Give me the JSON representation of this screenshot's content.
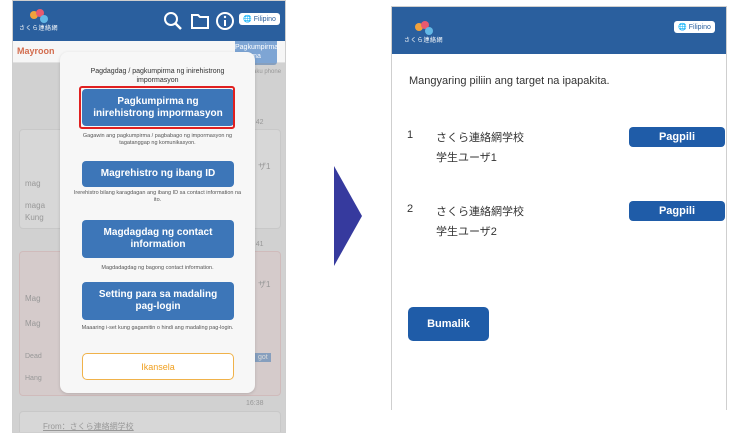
{
  "left_screen": {
    "logo_text": "さくら連絡網",
    "language_label": "Filipino",
    "subheader_name": "Mayroon",
    "subheader_button": "Pagkumpirma",
    "subheader_button_line2": "ma",
    "bg_snippets": {
      "phone": "aku phone",
      "time1": "16:42",
      "user1": "ザ1",
      "mag1": "mag",
      "mag2": "maga",
      "kung": "Kung",
      "time2": "16:41",
      "user2": "ザ1",
      "mag3": "Mag",
      "mag4": "Mag",
      "dead": "Dead",
      "hang": "Hang",
      "got": "got",
      "time3": "16:38",
      "from": "From：さくら連絡網学校"
    },
    "menu": {
      "title": "Pagdagdag / pagkumpirma ng inirehistrong impormasyon",
      "items": [
        {
          "label": "Pagkumpirma ng inirehistrong impormasyon",
          "description": "Gagawin ang pagkumpirma / pagbabago ng impormasyon ng tagatanggap ng komunikasyon."
        },
        {
          "label": "Magrehistro ng ibang ID",
          "description": "Irerehistro bilang karagdagan ang ibang ID sa contact information na ito."
        },
        {
          "label": "Magdagdag ng contact information",
          "description": "Magdadagdag ng bagong contact information."
        },
        {
          "label": "Setting para sa madaling pag-login",
          "description": "Maaaring i-set kung gagamitin o hindi ang madaling pag-login."
        }
      ],
      "cancel_label": "Ikansela"
    }
  },
  "right_screen": {
    "logo_text": "さくら連絡網",
    "language_label": "Filipino",
    "prompt": "Mangyaring piliin ang target na ipapakita.",
    "targets": [
      {
        "number": "1",
        "school": "さくら連絡網学校",
        "user": "学生ユーザ1",
        "select_label": "Pagpili"
      },
      {
        "number": "2",
        "school": "さくら連絡網学校",
        "user": "学生ユーザ2",
        "select_label": "Pagpili"
      }
    ],
    "back_label": "Bumalik"
  },
  "colors": {
    "header": "#2a5f9e",
    "menu_button": "#3d76b8",
    "primary_button": "#1f5ca8",
    "highlight": "#e02020",
    "cancel_border": "#f0b24a",
    "arrow": "#363a9e"
  },
  "icons": [
    "search-icon",
    "folder-icon",
    "info-icon",
    "globe-icon"
  ]
}
